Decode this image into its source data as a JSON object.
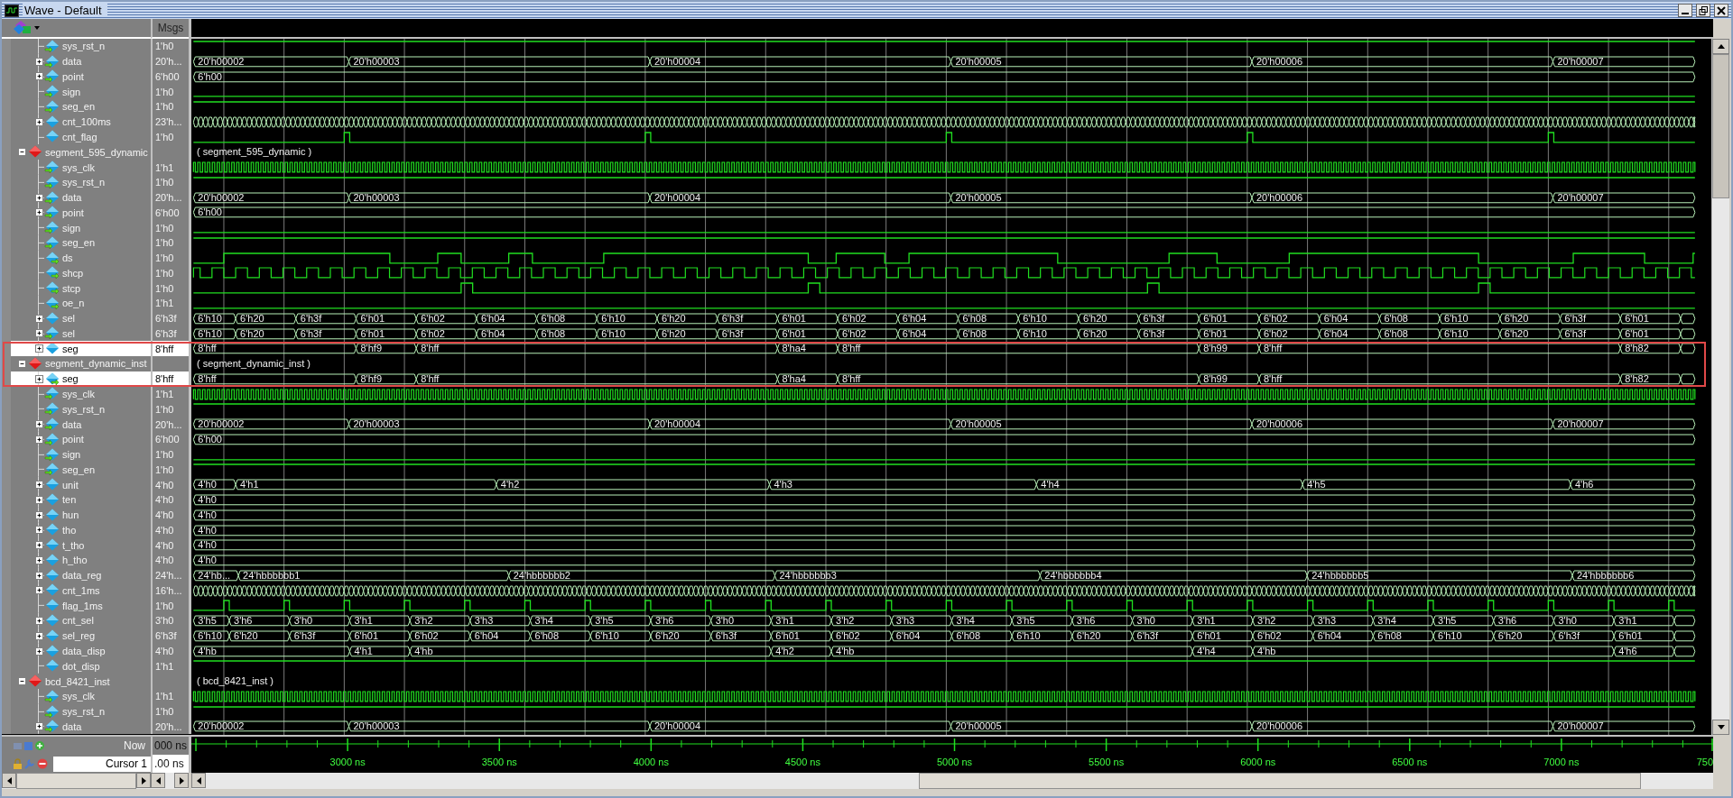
{
  "window": {
    "title": "Wave - Default"
  },
  "header": {
    "msgs": "Msgs"
  },
  "signals": [
    {
      "kind": "continued",
      "children": [
        {
          "name": "sys_rst_n",
          "msg": "1'h0",
          "kind": "input",
          "selected": false,
          "boxed": false,
          "wave": {
            "kind": "high"
          }
        },
        {
          "name": "data",
          "msg": "20'h...",
          "kind": "input",
          "expanded": false,
          "selected": false,
          "boxed": false,
          "wave": {
            "kind": "bus",
            "values": [
              "20'h00002",
              "20'h00003",
              "20'h00004",
              "20'h00005",
              "20'h00006",
              "20'h00007"
            ]
          }
        },
        {
          "name": "point",
          "msg": "6'h00",
          "kind": "input",
          "expanded": false,
          "selected": false,
          "boxed": false,
          "wave": {
            "kind": "fixed",
            "values": [
              "6'h00"
            ]
          }
        },
        {
          "name": "sign",
          "msg": "1'h0",
          "kind": "input",
          "selected": false,
          "boxed": false,
          "wave": {
            "kind": "low"
          }
        },
        {
          "name": "seg_en",
          "msg": "1'h0",
          "kind": "input",
          "selected": false,
          "boxed": false,
          "wave": {
            "kind": "high"
          }
        },
        {
          "name": "cnt_100ms",
          "msg": "23'h...",
          "kind": "internal",
          "expanded": false,
          "selected": false,
          "boxed": false,
          "wave": {
            "kind": "counter"
          }
        },
        {
          "name": "cnt_flag",
          "msg": "1'h0",
          "kind": "internal",
          "selected": false,
          "boxed": false,
          "wave": {
            "kind": "pulse"
          }
        }
      ]
    },
    {
      "name": "segment_595_dynamic",
      "kind": "instance",
      "expanded": true,
      "selected": false,
      "boxed": false,
      "wave_text": "( segment_595_dynamic )",
      "children": [
        {
          "name": "sys_clk",
          "msg": "1'h1",
          "kind": "input",
          "selected": false,
          "boxed": false,
          "wave": {
            "kind": "clock"
          }
        },
        {
          "name": "sys_rst_n",
          "msg": "1'h0",
          "kind": "input",
          "selected": false,
          "boxed": false,
          "wave": {
            "kind": "high"
          }
        },
        {
          "name": "data",
          "msg": "20'h...",
          "kind": "input",
          "expanded": false,
          "selected": false,
          "boxed": false,
          "wave": {
            "kind": "bus",
            "values": [
              "20'h00002",
              "20'h00003",
              "20'h00004",
              "20'h00005",
              "20'h00006",
              "20'h00007"
            ]
          }
        },
        {
          "name": "point",
          "msg": "6'h00",
          "kind": "input",
          "expanded": false,
          "selected": false,
          "boxed": false,
          "wave": {
            "kind": "fixed",
            "values": [
              "6'h00"
            ]
          }
        },
        {
          "name": "sign",
          "msg": "1'h0",
          "kind": "input",
          "selected": false,
          "boxed": false,
          "wave": {
            "kind": "low"
          }
        },
        {
          "name": "seg_en",
          "msg": "1'h0",
          "kind": "input",
          "selected": false,
          "boxed": false,
          "wave": {
            "kind": "high"
          }
        },
        {
          "name": "ds",
          "msg": "1'h0",
          "kind": "output",
          "selected": false,
          "boxed": false,
          "wave": {
            "kind": "serial"
          }
        },
        {
          "name": "shcp",
          "msg": "1'h0",
          "kind": "output",
          "selected": false,
          "boxed": false,
          "wave": {
            "kind": "shiftclock"
          }
        },
        {
          "name": "stcp",
          "msg": "1'h0",
          "kind": "output",
          "selected": false,
          "boxed": false,
          "wave": {
            "kind": "strobe"
          }
        },
        {
          "name": "oe_n",
          "msg": "1'h1",
          "kind": "output",
          "selected": false,
          "boxed": false,
          "wave": {
            "kind": "low"
          }
        },
        {
          "name": "sel",
          "msg": "6'h3f",
          "kind": "internal",
          "expanded": false,
          "selected": false,
          "boxed": false,
          "wave": {
            "kind": "select",
            "values": [
              "6'h10",
              "6'h20",
              "6'h3f",
              "6'h01",
              "6'h02",
              "6'h04",
              "6'h08",
              "6'h10",
              "6'h20",
              "6'h3f",
              "6'h01",
              "6'h02",
              "6'h04",
              "6'h08",
              "6'h10",
              "6'h20",
              "6'h3f",
              "6'h01",
              "6'h02",
              "6'h04",
              "6'h08",
              "6'h10",
              "6'h20",
              "6'h3f",
              "6'h01"
            ]
          }
        },
        {
          "name": "sel",
          "msg": "6'h3f",
          "kind": "input",
          "expanded": false,
          "selected": false,
          "boxed": false,
          "wave": {
            "kind": "select",
            "values": [
              "6'h10",
              "6'h20",
              "6'h3f",
              "6'h01",
              "6'h02",
              "6'h04",
              "6'h08",
              "6'h10",
              "6'h20",
              "6'h3f",
              "6'h01",
              "6'h02",
              "6'h04",
              "6'h08",
              "6'h10",
              "6'h20",
              "6'h3f",
              "6'h01",
              "6'h02",
              "6'h04",
              "6'h08",
              "6'h10",
              "6'h20",
              "6'h3f",
              "6'h01"
            ]
          }
        },
        {
          "name": "seg",
          "msg": "8'hff",
          "kind": "internal",
          "expanded": false,
          "selected": true,
          "boxed": true,
          "wave": {
            "kind": "digit",
            "values": [
              "8'hff",
              "8'hf9",
              "8'hff",
              "8'ha4",
              "8'hff",
              "8'h99",
              "8'hff",
              "8'h82"
            ]
          }
        }
      ]
    },
    {
      "name": "segment_dynamic_inst",
      "kind": "instance",
      "expanded": true,
      "selected": false,
      "boxed": true,
      "wave_text": "( segment_dynamic_inst )",
      "children": [
        {
          "name": "seg",
          "msg": "8'hff",
          "kind": "output",
          "expanded": false,
          "selected": true,
          "boxed": true,
          "wave": {
            "kind": "digit",
            "values": [
              "8'hff",
              "8'hf9",
              "8'hff",
              "8'ha4",
              "8'hff",
              "8'h99",
              "8'hff",
              "8'h82"
            ]
          }
        },
        {
          "name": "sys_clk",
          "msg": "1'h1",
          "kind": "input",
          "selected": false,
          "boxed": false,
          "wave": {
            "kind": "clock"
          }
        },
        {
          "name": "sys_rst_n",
          "msg": "1'h0",
          "kind": "input",
          "selected": false,
          "boxed": false,
          "wave": {
            "kind": "high"
          }
        },
        {
          "name": "data",
          "msg": "20'h...",
          "kind": "input",
          "expanded": false,
          "selected": false,
          "boxed": false,
          "wave": {
            "kind": "bus",
            "values": [
              "20'h00002",
              "20'h00003",
              "20'h00004",
              "20'h00005",
              "20'h00006",
              "20'h00007"
            ]
          }
        },
        {
          "name": "point",
          "msg": "6'h00",
          "kind": "input",
          "expanded": false,
          "selected": false,
          "boxed": false,
          "wave": {
            "kind": "fixed",
            "values": [
              "6'h00"
            ]
          }
        },
        {
          "name": "sign",
          "msg": "1'h0",
          "kind": "input",
          "selected": false,
          "boxed": false,
          "wave": {
            "kind": "low"
          }
        },
        {
          "name": "seg_en",
          "msg": "1'h0",
          "kind": "input",
          "selected": false,
          "boxed": false,
          "wave": {
            "kind": "high"
          }
        },
        {
          "name": "unit",
          "msg": "4'h0",
          "kind": "internal",
          "expanded": false,
          "selected": false,
          "boxed": false,
          "wave": {
            "kind": "slowbus",
            "values": [
              "4'h0",
              "4'h1",
              "4'h2",
              "4'h3",
              "4'h4",
              "4'h5",
              "4'h6"
            ]
          }
        },
        {
          "name": "ten",
          "msg": "4'h0",
          "kind": "internal",
          "expanded": false,
          "selected": false,
          "boxed": false,
          "wave": {
            "kind": "fixed",
            "values": [
              "4'h0"
            ]
          }
        },
        {
          "name": "hun",
          "msg": "4'h0",
          "kind": "internal",
          "expanded": false,
          "selected": false,
          "boxed": false,
          "wave": {
            "kind": "fixed",
            "values": [
              "4'h0"
            ]
          }
        },
        {
          "name": "tho",
          "msg": "4'h0",
          "kind": "internal",
          "expanded": false,
          "selected": false,
          "boxed": false,
          "wave": {
            "kind": "fixed",
            "values": [
              "4'h0"
            ]
          }
        },
        {
          "name": "t_tho",
          "msg": "4'h0",
          "kind": "internal",
          "expanded": false,
          "selected": false,
          "boxed": false,
          "wave": {
            "kind": "fixed",
            "values": [
              "4'h0"
            ]
          }
        },
        {
          "name": "h_tho",
          "msg": "4'h0",
          "kind": "internal",
          "expanded": false,
          "selected": false,
          "boxed": false,
          "wave": {
            "kind": "fixed",
            "values": [
              "4'h0"
            ]
          }
        },
        {
          "name": "data_reg",
          "msg": "24'h...",
          "kind": "internal",
          "expanded": false,
          "selected": false,
          "boxed": false,
          "wave": {
            "kind": "widebus",
            "values": [
              "24'hb...",
              "24'hbbbbbb1",
              "24'hbbbbbb2",
              "24'hbbbbbb3",
              "24'hbbbbbb4",
              "24'hbbbbbb5",
              "24'hbbbbbb6"
            ]
          }
        },
        {
          "name": "cnt_1ms",
          "msg": "16'h...",
          "kind": "internal",
          "expanded": false,
          "selected": false,
          "boxed": false,
          "wave": {
            "kind": "counter"
          }
        },
        {
          "name": "flag_1ms",
          "msg": "1'h0",
          "kind": "internal",
          "selected": false,
          "boxed": false,
          "wave": {
            "kind": "tick"
          }
        },
        {
          "name": "cnt_sel",
          "msg": "3'h0",
          "kind": "internal",
          "expanded": false,
          "selected": false,
          "boxed": false,
          "wave": {
            "kind": "register",
            "values": [
              "3'h5",
              "3'h6",
              "3'h0",
              "3'h1",
              "3'h2",
              "3'h3",
              "3'h4",
              "3'h5",
              "3'h6",
              "3'h0",
              "3'h1",
              "3'h2",
              "3'h3",
              "3'h4",
              "3'h5",
              "3'h6",
              "3'h0",
              "3'h1",
              "3'h2",
              "3'h3",
              "3'h4",
              "3'h5",
              "3'h6",
              "3'h0",
              "3'h1"
            ]
          }
        },
        {
          "name": "sel_reg",
          "msg": "6'h3f",
          "kind": "internal",
          "expanded": false,
          "selected": false,
          "boxed": false,
          "wave": {
            "kind": "register",
            "values": [
              "6'h10",
              "6'h20",
              "6'h3f",
              "6'h01",
              "6'h02",
              "6'h04",
              "6'h08",
              "6'h10",
              "6'h20",
              "6'h3f",
              "6'h01",
              "6'h02",
              "6'h04",
              "6'h08",
              "6'h10",
              "6'h20",
              "6'h3f",
              "6'h01",
              "6'h02",
              "6'h04",
              "6'h08",
              "6'h10",
              "6'h20",
              "6'h3f",
              "6'h01"
            ]
          }
        },
        {
          "name": "data_disp",
          "msg": "4'h0",
          "kind": "internal",
          "expanded": false,
          "selected": false,
          "boxed": false,
          "wave": {
            "kind": "digitreg",
            "values": [
              "4'hb",
              "4'h1",
              "4'hb",
              "4'h2",
              "4'hb",
              "4'h4",
              "4'hb",
              "4'h6"
            ]
          }
        },
        {
          "name": "dot_disp",
          "msg": "1'h1",
          "kind": "internal",
          "selected": false,
          "boxed": false,
          "wave": {
            "kind": "high"
          }
        }
      ]
    },
    {
      "name": "bcd_8421_inst",
      "kind": "instance",
      "expanded": true,
      "selected": false,
      "boxed": false,
      "wave_text": "( bcd_8421_inst )",
      "children": [
        {
          "name": "sys_clk",
          "msg": "1'h1",
          "kind": "input",
          "selected": false,
          "boxed": false,
          "wave": {
            "kind": "clock"
          }
        },
        {
          "name": "sys_rst_n",
          "msg": "1'h0",
          "kind": "input",
          "selected": false,
          "boxed": false,
          "wave": {
            "kind": "high"
          }
        },
        {
          "name": "data",
          "msg": "20'h...",
          "kind": "input",
          "expanded": false,
          "selected": false,
          "boxed": false,
          "wave": {
            "kind": "bus",
            "values": [
              "20'h00002",
              "20'h00003",
              "20'h00004",
              "20'h00005",
              "20'h00006",
              "20'h00007"
            ]
          }
        }
      ]
    }
  ],
  "footer": {
    "now_label": "Now",
    "now_value": "000 ns",
    "cursor_label": "Cursor 1",
    "cursor_value": ".00 ns"
  },
  "ruler": {
    "labels": [
      "3000 ns",
      "3500 ns",
      "4000 ns",
      "4500 ns",
      "5000 ns",
      "5500 ns",
      "6000 ns",
      "6500 ns",
      "7000 ns",
      "750"
    ]
  }
}
